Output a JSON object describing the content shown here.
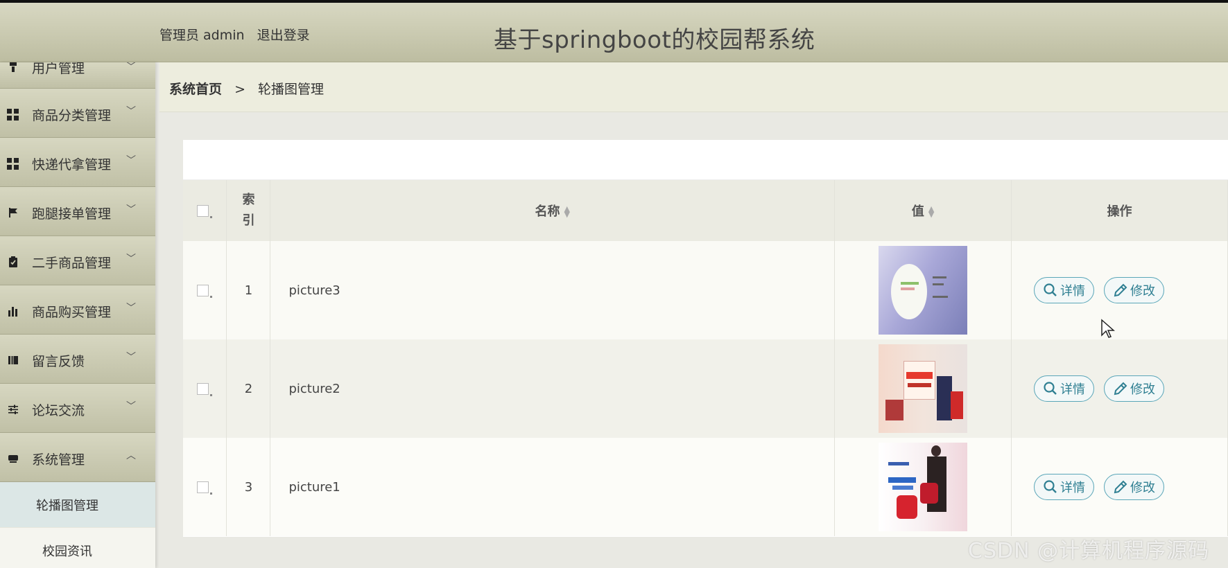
{
  "header": {
    "user_label": "管理员 admin",
    "logout_label": "退出登录",
    "title": "基于springboot的校园帮系统"
  },
  "sidebar": {
    "items": [
      {
        "label": "用户管理",
        "icon": "user-icon"
      },
      {
        "label": "商品分类管理",
        "icon": "grid-icon"
      },
      {
        "label": "快递代拿管理",
        "icon": "grid-icon"
      },
      {
        "label": "跑腿接单管理",
        "icon": "flag-icon"
      },
      {
        "label": "二手商品管理",
        "icon": "clipboard-check-icon"
      },
      {
        "label": "商品购买管理",
        "icon": "bar-chart-icon"
      },
      {
        "label": "留言反馈",
        "icon": "book-icon"
      },
      {
        "label": "论坛交流",
        "icon": "sliders-icon"
      },
      {
        "label": "系统管理",
        "icon": "monitor-icon"
      }
    ],
    "sub_items": [
      {
        "label": "轮播图管理",
        "active": true
      },
      {
        "label": "校园资讯",
        "active": false
      }
    ]
  },
  "breadcrumb": {
    "home": "系统首页",
    "separator": ">",
    "current": "轮播图管理"
  },
  "table": {
    "headers": {
      "index": "索引",
      "name": "名称",
      "value": "值",
      "actions": "操作"
    },
    "rows": [
      {
        "index": "1",
        "name": "picture3"
      },
      {
        "index": "2",
        "name": "picture2"
      },
      {
        "index": "3",
        "name": "picture1"
      }
    ],
    "detail_label": "详情",
    "edit_label": "修改"
  },
  "watermark": "CSDN @计算机程序源码",
  "colors": {
    "header_bg": "#c9c9b0",
    "button_border": "#5aa6b8",
    "active_submenu": "#dce7e6"
  }
}
